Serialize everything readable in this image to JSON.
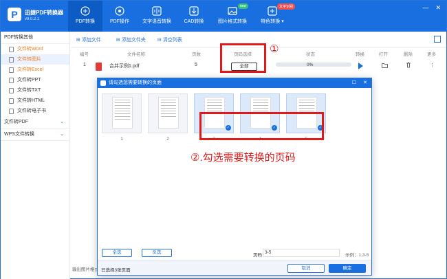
{
  "app": {
    "name": "迅捷PDF转换器",
    "version": "v9.0.2.1",
    "logo_letter": "P"
  },
  "nav": [
    {
      "label": "PDF转换",
      "icon": "pdf-convert-icon"
    },
    {
      "label": "PDF操作",
      "icon": "pdf-operate-icon"
    },
    {
      "label": "文字语音转换",
      "icon": "voice-icon"
    },
    {
      "label": "CAD转换",
      "icon": "cad-icon"
    },
    {
      "label": "图片格式转换",
      "icon": "image-icon",
      "badge": "new"
    },
    {
      "label": "特色转换",
      "icon": "special-icon",
      "badge": "文字识别",
      "dropdown": "▾"
    }
  ],
  "window_controls": {
    "min": "—",
    "close": "✕"
  },
  "sidebar": {
    "groups": [
      {
        "label": "PDF转换其他",
        "items": [
          "文件转Word",
          "文件转图片",
          "文件转Excel",
          "文件转PPT",
          "文件转TXT",
          "文件转HTML",
          "文件转电子书"
        ]
      },
      {
        "label": "文件转PDF",
        "chev": "⌄"
      },
      {
        "label": "WPS文件转换",
        "chev": "⌄"
      }
    ]
  },
  "toolbar": {
    "add_file": "添加文件",
    "add_folder": "添加文件夹",
    "clear": "清空列表"
  },
  "table": {
    "headers": [
      "编号",
      "文件名称",
      "页数",
      "页码选择",
      "状态",
      "转换",
      "打开",
      "删除",
      "更多"
    ],
    "row": {
      "index": "1",
      "name": "合并示例1.pdf",
      "pages": "5",
      "page_select": "全部",
      "progress": "0%",
      "more": "⋮"
    }
  },
  "annotations": {
    "circle_1": "①",
    "step_2": "②.勾选需要转换的页码"
  },
  "dialog": {
    "title": "请勾选您需要转换的页面",
    "ctrl_max": "☐",
    "ctrl_close": "✕",
    "pages": [
      {
        "num": "1",
        "selected": false
      },
      {
        "num": "2",
        "selected": false
      },
      {
        "num": "3",
        "selected": true
      },
      {
        "num": "4",
        "selected": true
      },
      {
        "num": "5",
        "selected": true
      }
    ],
    "check": "✓",
    "select_all": "全选",
    "invert": "反选",
    "pages_label": "页码",
    "pages_value": "3-5",
    "example": "示例：1,3-5",
    "selected_text": "已选择3张页面",
    "cancel": "取消",
    "ok": "确定"
  },
  "output_text": "输出图片格式"
}
